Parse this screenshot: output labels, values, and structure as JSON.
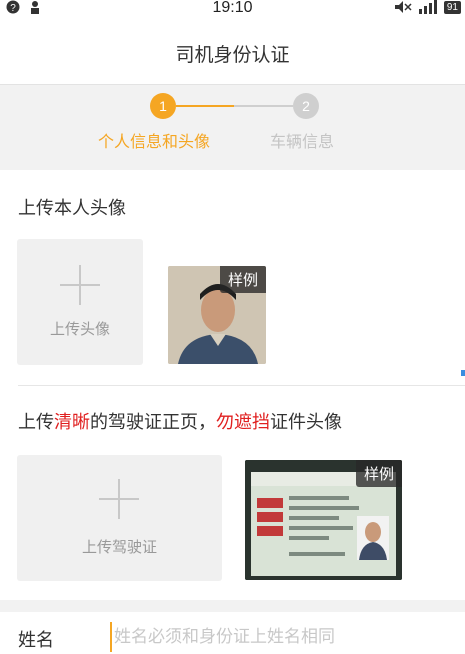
{
  "status_bar": {
    "time": "19:10",
    "battery": "91"
  },
  "nav": {
    "title": "司机身份认证"
  },
  "steps": {
    "step1_num": "1",
    "step1_label": "个人信息和头像",
    "step2_num": "2",
    "step2_label": "车辆信息"
  },
  "avatar_section": {
    "title": "上传本人头像",
    "upload_label": "上传头像",
    "sample_label": "样例"
  },
  "license_section": {
    "title_part1": "上传",
    "title_highlight1": "清晰",
    "title_part2": "的驾驶证正页，",
    "title_highlight2": "勿遮挡",
    "title_part3": "证件头像",
    "upload_label": "上传驾驶证",
    "sample_label": "样例"
  },
  "form": {
    "name_label": "姓名",
    "name_placeholder": "姓名必须和身份证上姓名相同"
  },
  "colors": {
    "accent": "#f5a623",
    "warning_red": "#e02020",
    "inactive": "#cfcfcf"
  }
}
